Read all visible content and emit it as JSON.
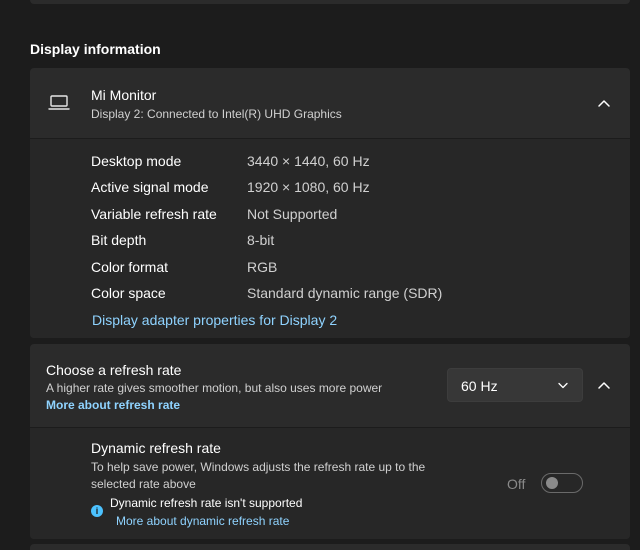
{
  "section": {
    "title": "Display information"
  },
  "monitor": {
    "icon": "laptop-icon",
    "name": "Mi Monitor",
    "subtitle": "Display 2: Connected to Intel(R) UHD Graphics",
    "details": [
      {
        "label": "Desktop mode",
        "value": "3440 × 1440, 60 Hz"
      },
      {
        "label": "Active signal mode",
        "value": "1920 × 1080, 60 Hz"
      },
      {
        "label": "Variable refresh rate",
        "value": "Not Supported"
      },
      {
        "label": "Bit depth",
        "value": "8-bit"
      },
      {
        "label": "Color format",
        "value": "RGB"
      },
      {
        "label": "Color space",
        "value": "Standard dynamic range (SDR)"
      }
    ],
    "adapter_link": "Display adapter properties for Display 2"
  },
  "refresh": {
    "title": "Choose a refresh rate",
    "description": "A higher rate gives smoother motion, but also uses more power",
    "more_link": "More about refresh rate",
    "selected_rate": "60 Hz",
    "dynamic": {
      "title": "Dynamic refresh rate",
      "description": "To help save power, Windows adjusts the refresh rate up to the selected rate above",
      "note": "Dynamic refresh rate isn't supported",
      "more_link": "More about dynamic refresh rate",
      "toggle_label": "Off",
      "toggle_on": false
    }
  },
  "colors": {
    "background": "#1c1c1c",
    "card": "#2b2b2b",
    "link": "#8fd3ff",
    "info_accent": "#4cc2ff"
  }
}
